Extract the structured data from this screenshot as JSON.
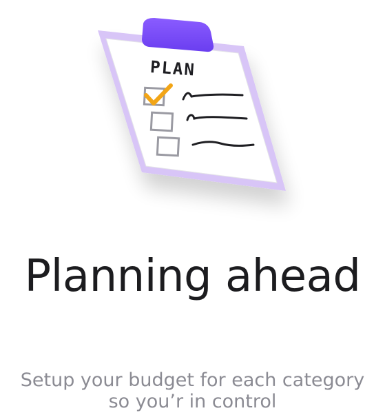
{
  "illustration": {
    "icon": "clipboard-plan-icon",
    "label": "PLAN",
    "clip_color": "#7b4dfa",
    "frame_color": "#d5c2f6",
    "check_color": "#f2a516"
  },
  "title": "Planning ahead",
  "subtitle": {
    "line1": "Setup your budget for each category",
    "line2": "so you’r in control"
  }
}
